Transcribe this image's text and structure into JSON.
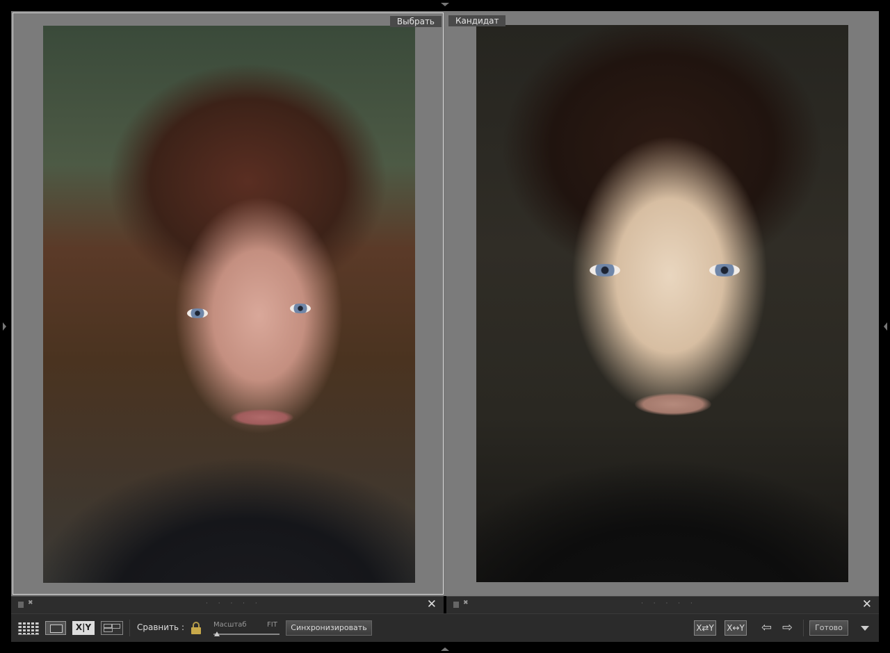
{
  "panes": {
    "left_label": "Выбрать",
    "right_label": "Кандидат"
  },
  "info_bar": {
    "stars": "· · · · ·",
    "close_glyph": "✕"
  },
  "toolbar": {
    "compare_label": "Сравнить :",
    "compare_view_label": "X|Y",
    "zoom_label": "Масштаб",
    "zoom_value": "FIT",
    "zoom_level": 0,
    "sync_label": "Синхронизировать",
    "swap_label": "X⇄Y",
    "promote_label": "X↔Y",
    "prev_arrow": "⇦",
    "next_arrow": "⇨",
    "done_label": "Готово"
  },
  "colors": {
    "background": "#000000",
    "compare_bg": "#7a7a7a",
    "toolbar_bg": "#2b2b2b",
    "label_bg": "#4a4a4a",
    "lock_accent": "#c8a94a"
  },
  "icons": [
    "grid-icon",
    "loupe-icon",
    "compare-icon",
    "survey-icon",
    "lock-icon",
    "swap-icon",
    "promote-icon",
    "arrow-left-icon",
    "arrow-right-icon",
    "chevron-down-icon",
    "flag-icon",
    "reject-icon",
    "close-icon"
  ]
}
